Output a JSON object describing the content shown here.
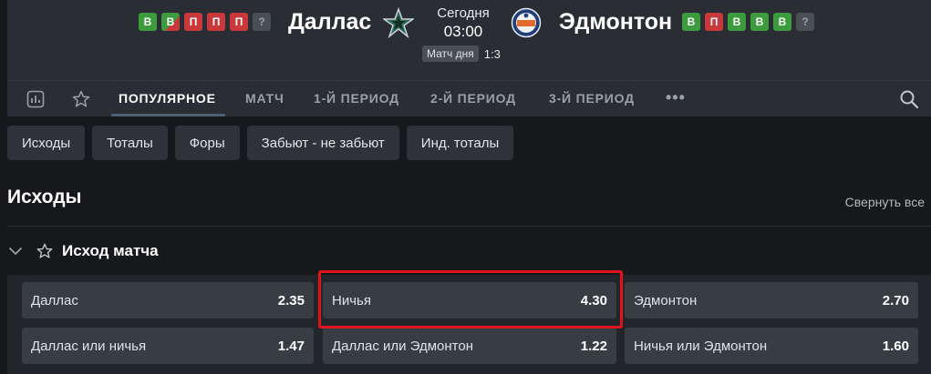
{
  "header": {
    "home_team": "Даллас",
    "away_team": "Эдмонтон",
    "day": "Сегодня",
    "time": "03:00",
    "match_of_day": "Матч дня",
    "ratio": "1:3",
    "home_form": [
      "В",
      "В",
      "П",
      "П",
      "П",
      "?"
    ],
    "away_form": [
      "В",
      "П",
      "В",
      "В",
      "В",
      "?"
    ],
    "colors": {
      "win": "#3c9b3c",
      "loss": "#c9393b",
      "unknown": "#4a4e55"
    },
    "home_logo": "stars-logo-icon",
    "away_logo": "oilers-logo-icon"
  },
  "tabs": {
    "stats_icon": "stats-icon",
    "favorite_icon": "star-icon",
    "items": [
      "ПОПУЛЯРНОЕ",
      "МАТЧ",
      "1-Й ПЕРИОД",
      "2-Й ПЕРИОД",
      "3-Й ПЕРИОД"
    ],
    "active_index": 0,
    "more": "•••",
    "search_icon": "search-icon"
  },
  "chips": [
    "Исходы",
    "Тоталы",
    "Форы",
    "Забьют - не забьют",
    "Инд. тоталы"
  ],
  "section": {
    "title": "Исходы",
    "collapse_all": "Свернуть все"
  },
  "market": {
    "title": "Исход матча",
    "odds": [
      {
        "label": "Даллас",
        "value": "2.35"
      },
      {
        "label": "Ничья",
        "value": "4.30"
      },
      {
        "label": "Эдмонтон",
        "value": "2.70"
      },
      {
        "label": "Даллас или ничья",
        "value": "1.47"
      },
      {
        "label": "Даллас или Эдмонтон",
        "value": "1.22"
      },
      {
        "label": "Ничья или Эдмонтон",
        "value": "1.60"
      }
    ],
    "highlight_color": "#e0151c"
  }
}
